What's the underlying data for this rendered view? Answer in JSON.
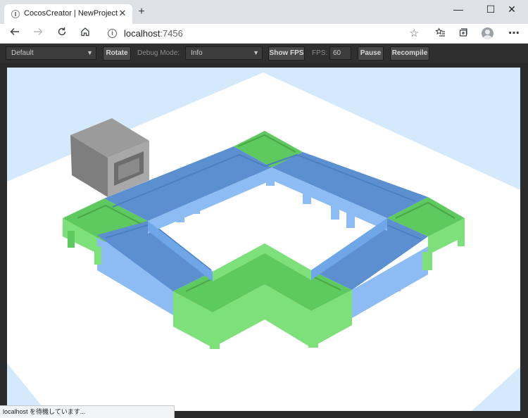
{
  "browser": {
    "tab_title": "CocosCreator | NewProject",
    "tab_close": "✕",
    "new_tab": "+",
    "url_host": "localhost",
    "url_port": ":7456",
    "window_controls": {
      "minimize": "—",
      "maximize": "☐",
      "close": "✕"
    }
  },
  "toolbar": {
    "scene_select": "Default",
    "rotate_label": "Rotate",
    "debug_mode_label": "Debug Mode:",
    "debug_mode_value": "Info",
    "show_fps_label": "Show FPS",
    "fps_label": "FPS:",
    "fps_value": "60",
    "pause_label": "Pause",
    "recompile_label": "Recompile"
  },
  "status": {
    "text": "localhost を待機しています..."
  },
  "icons": {
    "back": "back-arrow-icon",
    "forward": "forward-arrow-icon",
    "reload": "reload-icon",
    "home": "home-icon",
    "info": "info-icon",
    "favorite": "star-icon",
    "favorites_list": "favorites-list-icon",
    "collections": "collections-icon",
    "profile": "profile-avatar-icon"
  },
  "colors": {
    "sky": "#d4e9fb",
    "ground": "#ffffff",
    "track_green_top": "#5ec95e",
    "track_green_side": "#7de07b",
    "track_blue_top": "#5b8fcf",
    "track_blue_side": "#8dbcf5",
    "cube_gray": "#8e8e8e"
  }
}
